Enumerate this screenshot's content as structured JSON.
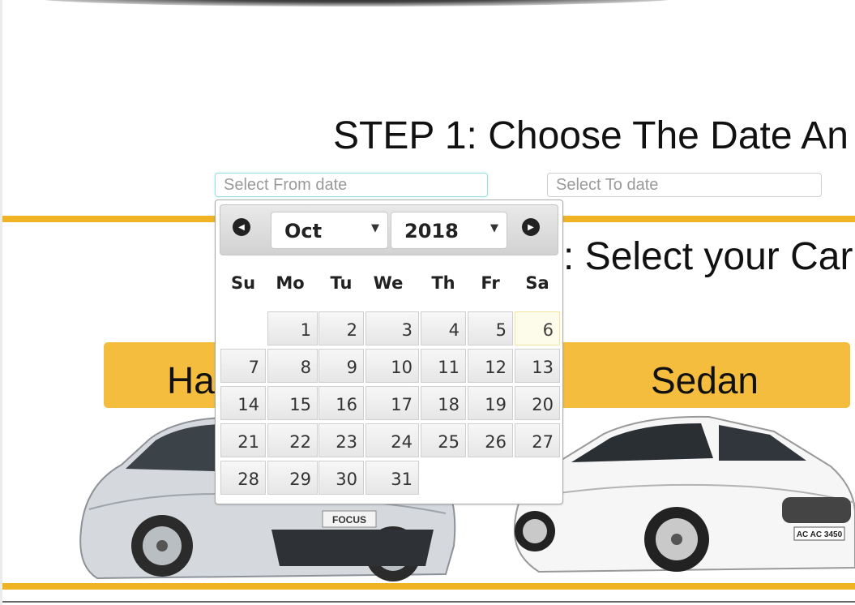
{
  "step1": {
    "title": "STEP 1: Choose The Date An"
  },
  "from_date": {
    "placeholder": "Select From date",
    "value": ""
  },
  "to_date": {
    "placeholder": "Select To date",
    "value": ""
  },
  "step2": {
    "title": ": Select your Car"
  },
  "car_tabs": [
    {
      "label": "Ha"
    },
    {
      "label": "Sedan"
    }
  ],
  "car_images": {
    "hatchback_badge": "FOCUS",
    "sedan_plate": "AC AC 3450"
  },
  "datepicker": {
    "prev_icon": "circle-arrow-left-icon",
    "next_icon": "circle-arrow-right-icon",
    "month": "Oct",
    "year": "2018",
    "weekdays": [
      "Su",
      "Mo",
      "Tu",
      "We",
      "Th",
      "Fr",
      "Sa"
    ],
    "weeks": [
      [
        "",
        "1",
        "2",
        "3",
        "4",
        "5",
        "6"
      ],
      [
        "7",
        "8",
        "9",
        "10",
        "11",
        "12",
        "13"
      ],
      [
        "14",
        "15",
        "16",
        "17",
        "18",
        "19",
        "20"
      ],
      [
        "21",
        "22",
        "23",
        "24",
        "25",
        "26",
        "27"
      ],
      [
        "28",
        "29",
        "30",
        "31",
        "",
        "",
        ""
      ]
    ],
    "today": "6"
  },
  "colors": {
    "accent_yellow": "#f0b323",
    "tab_yellow": "#f5bd3e",
    "today_highlight": "#fdfbe9"
  }
}
